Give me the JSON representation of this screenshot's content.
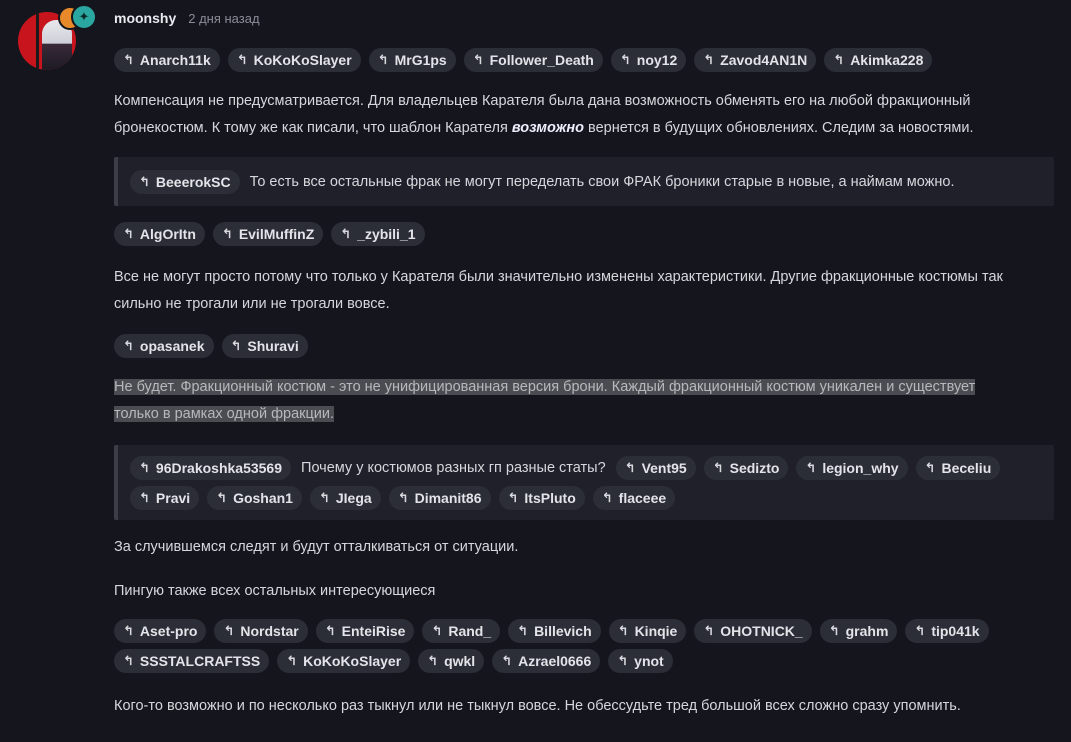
{
  "author": {
    "name": "moonshy",
    "time": "2 дня назад"
  },
  "mentions1": [
    "Anarch11k",
    "KoKoKoSlayer",
    "MrG1ps",
    "Follower_Death",
    "noy12",
    "Zavod4AN1N",
    "Akimka228"
  ],
  "para1_a": "Компенсация не предусматривается. Для владельцев Карателя была дана возможность обменять его на любой фракционный бронекостюм. К тому же как писали, что шаблон Карателя ",
  "para1_em": "возможно",
  "para1_b": " вернется в будущих обновлениях. Следим за новостями.",
  "quote1": {
    "user": "BeeerokSC",
    "text": "То есть все остальные фрак не могут переделать свои ФРАК броники старые в новые, а наймам можно."
  },
  "mentions2": [
    "AlgOrItn",
    "EvilMuffinZ",
    "_zybili_1"
  ],
  "para2": "Все не могут просто потому что только у Карателя были значительно изменены характеристики. Другие фракционные костюмы так сильно не трогали или не трогали вовсе.",
  "mentions3": [
    "opasanek",
    "Shuravi"
  ],
  "para3_line1": "Не будет. Фракционный костюм - это не унифицированная версия брони. Каждый фракционный костюм уникален и существует",
  "para3_line2": "только в рамках одной фракции.",
  "quote2": {
    "user": "96Drakoshka53569",
    "text": "Почему у костюмов разных гп разные статы?",
    "mentions": [
      "Vent95",
      "Sedizto",
      "legion_why",
      "Beceliu",
      "Pravi",
      "Goshan1",
      "JIega",
      "Dimanit86",
      "ItsPluto",
      "flaceee"
    ]
  },
  "para4": "За случившемся следят и будут отталкиваться от ситуации.",
  "para5": "Пингую также всех остальных интересующиеся",
  "mentions4": [
    "Aset-pro",
    "Nordstar",
    "EnteiRise",
    "Rand_",
    "Billevich",
    "Kinqie",
    "OHOTNICK_",
    "grahm",
    "tip041k",
    "SSSTALCRAFTSS",
    "KoKoKoSlayer",
    "qwkl",
    "Azrael0666",
    "ynot"
  ],
  "para6": "Кого-то возможно и по несколько раз тыкнул или не тыкнул вовсе. Не обессудьте тред большой всех сложно сразу упомнить.",
  "icons": {
    "reply": "reply-icon",
    "badge": "star-badge-icon"
  },
  "colors": {
    "bg": "#15161d",
    "chip": "#2c2e37",
    "highlight": "#4b4c51"
  }
}
